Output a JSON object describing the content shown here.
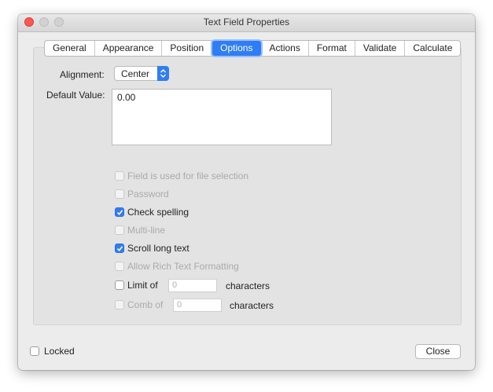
{
  "window": {
    "title": "Text Field Properties"
  },
  "tabs": [
    {
      "label": "General"
    },
    {
      "label": "Appearance"
    },
    {
      "label": "Position"
    },
    {
      "label": "Options"
    },
    {
      "label": "Actions"
    },
    {
      "label": "Format"
    },
    {
      "label": "Validate"
    },
    {
      "label": "Calculate"
    }
  ],
  "active_tab": "Options",
  "alignment": {
    "label": "Alignment:",
    "value": "Center"
  },
  "default_value": {
    "label": "Default Value:",
    "value": "0.00"
  },
  "options": [
    {
      "label": "Field is used for file selection",
      "checked": false,
      "enabled": false
    },
    {
      "label": "Password",
      "checked": false,
      "enabled": false
    },
    {
      "label": "Check spelling",
      "checked": true,
      "enabled": true
    },
    {
      "label": "Multi-line",
      "checked": false,
      "enabled": false
    },
    {
      "label": "Scroll long text",
      "checked": true,
      "enabled": true
    },
    {
      "label": "Allow Rich Text Formatting",
      "checked": false,
      "enabled": false
    }
  ],
  "limit": {
    "label": "Limit of",
    "placeholder": "0",
    "suffix": "characters",
    "checked": false,
    "enabled": true
  },
  "comb": {
    "label": "Comb of",
    "placeholder": "0",
    "suffix": "characters",
    "checked": false,
    "enabled": false
  },
  "footer": {
    "locked_label": "Locked",
    "locked_checked": false,
    "close_label": "Close"
  },
  "colors": {
    "accent": "#2f7df6",
    "close_light": "#fc5753",
    "disabled_text": "#aaaaaa"
  }
}
